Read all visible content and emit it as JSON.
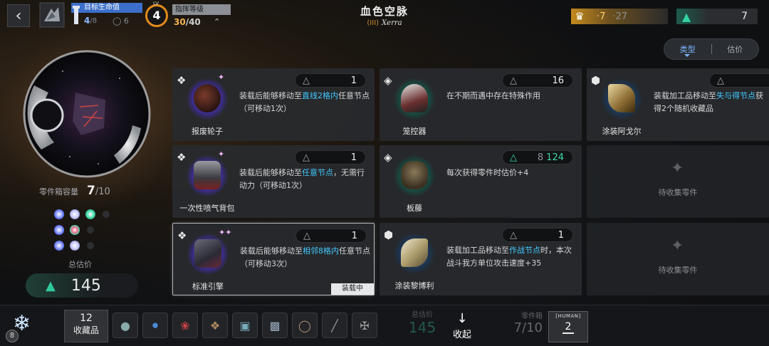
{
  "header": {
    "title": "血色空脉",
    "subtitle_tier": "(III)",
    "subtitle_glyph": "Xerra",
    "goal_label": "目标生命值",
    "goal_current": "4",
    "goal_max": "/8",
    "goal_aux": "6",
    "command_level": "4",
    "command_lv_tag": "LV",
    "command_label": "指挥等级",
    "command_xp": "30",
    "command_xp_max": "/40"
  },
  "resources": {
    "gold_a": "·7",
    "gold_b": "·27",
    "green": "7"
  },
  "sort": {
    "active": "类型",
    "inactive": "估价"
  },
  "left_panel": {
    "capacity_label": "零件箱容量",
    "capacity_current": "7",
    "capacity_max": "/10",
    "estimate_label": "总估价",
    "estimate_value": "145"
  },
  "cards": [
    {
      "name": "报废轮子",
      "price": "1",
      "desc_pre": "装载后能够移动至",
      "desc_hl": "直线2格内",
      "desc_post": "任意节点（可移动1次）",
      "rarity_icon": "crystal-icon"
    },
    {
      "name": "笼控器",
      "price": "16",
      "desc_pre": "在不期而遇中存在特殊作用",
      "desc_hl": "",
      "desc_post": "",
      "rarity_icon": "diamond-icon"
    },
    {
      "name": "涂装阿戈尔",
      "price": "",
      "desc_pre": "装载加工品移动至",
      "desc_hl": "失与得节点",
      "desc_post": "获得2个随机收藏品",
      "rarity_icon": "cube-icon"
    },
    {
      "name": "一次性喷气背包",
      "price": "1",
      "desc_pre": "装载后能够移动至",
      "desc_hl": "任意节点",
      "desc_post": "，无需行动力（可移动1次）",
      "rarity_icon": "crystal-icon"
    },
    {
      "name": "板藤",
      "price_old": "8",
      "price_new": "124",
      "desc_pre": "每次获得零件时估价+4",
      "desc_hl": "",
      "desc_post": "",
      "rarity_icon": "diamond-icon"
    },
    {
      "name": "标准引擎",
      "price": "1",
      "desc_pre": "装载后能够移动至",
      "desc_hl": "相邻8格内",
      "desc_post": "任意节点（可移动3次）",
      "rarity_icon": "crystal-icon",
      "status": "装载中"
    },
    {
      "name": "涂装黎博利",
      "price": "1",
      "desc_pre": "装载加工品移动至",
      "desc_hl": "作战节点",
      "desc_post": "时，本次战斗我方单位攻击速度+35",
      "rarity_icon": "cube-icon"
    }
  ],
  "empty_slot_text": "待收集零件",
  "bottom": {
    "level": "8",
    "collect_count": "12",
    "collect_label": "收藏品",
    "est_label": "总估价",
    "est_value": "145",
    "collapse_label": "收起",
    "box_label": "零件箱",
    "box_value": "7/10",
    "human_tag": "[HUMAN]",
    "human_count": "2"
  },
  "colors": {
    "accent_blue": "#42c9ff",
    "accent_green": "#3fd8a8",
    "gold": "#c48a1e",
    "command_orange": "#e38a1c"
  }
}
